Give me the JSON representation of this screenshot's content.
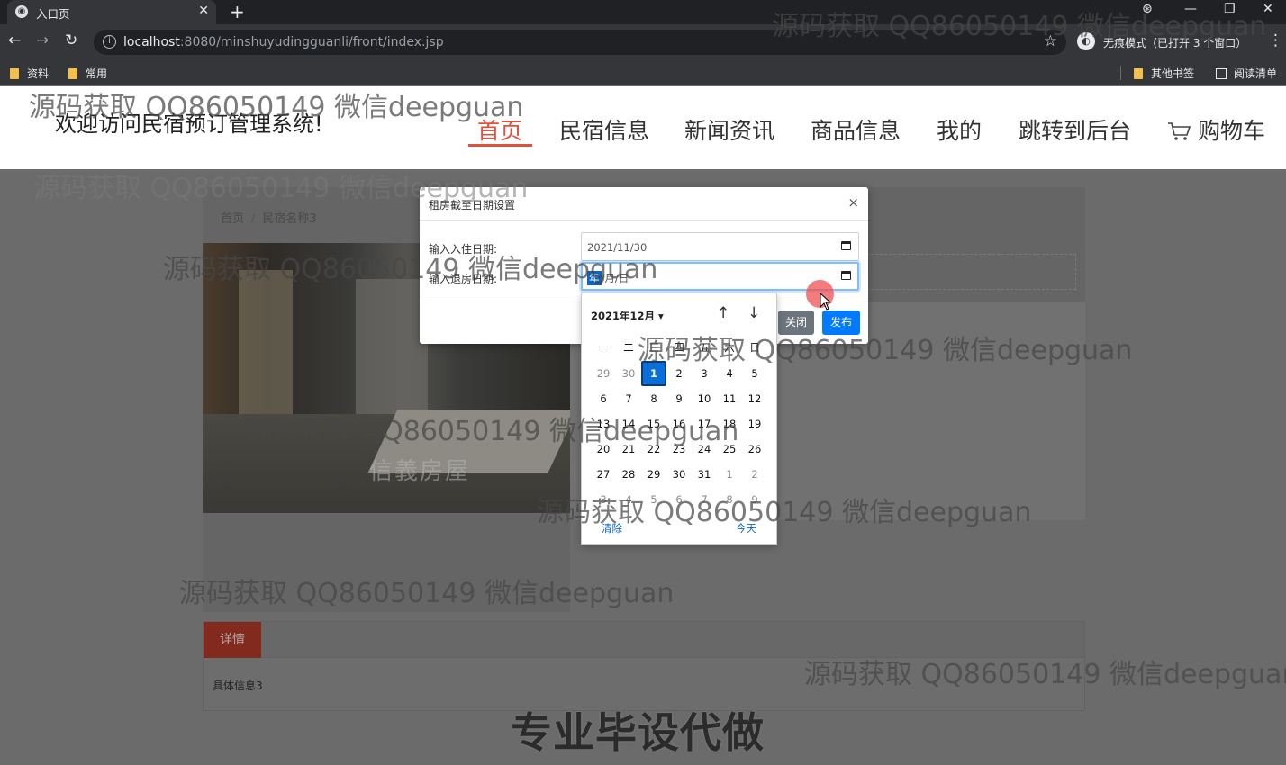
{
  "browser": {
    "tab_title": "入口页",
    "tab_close": "✕",
    "new_tab": "+",
    "url_host": "localhost",
    "url_path": ":8080/minshuyudingguanli/front/index.jsp",
    "incognito_label": "无痕模式（已打开 3 个窗口）",
    "bookmarks": [
      "资料",
      "常用"
    ],
    "bookmarks_right": [
      "其他书签",
      "阅读清单"
    ]
  },
  "site": {
    "title": "欢迎访问民宿预订管理系统!",
    "nav": [
      "首页",
      "民宿信息",
      "新闻资讯",
      "商品信息",
      "我的",
      "跳转到后台",
      "购物车"
    ],
    "active_nav": "首页",
    "accent_color": "#e0503a"
  },
  "breadcrumb": {
    "home": "首页",
    "separator": "/",
    "current": "民宿名称3"
  },
  "photo_watermark": "信義房屋",
  "detail": {
    "tab_label": "详情",
    "text": "具体信息3"
  },
  "banner": "专业毕设代做",
  "modal": {
    "title": "租房截至日期设置",
    "close_icon": "×",
    "checkin_label": "输入入住日期:",
    "checkin_value": "2021/11/30",
    "checkout_label": "输入退房日期:",
    "checkout_year_seg": "年",
    "checkout_rest": "/月/日",
    "btn_close": "关闭",
    "btn_publish": "发布"
  },
  "calendar": {
    "month_label": "2021年12月 ▾",
    "weekdays": [
      "一",
      "二",
      "三",
      "四",
      "五",
      "六",
      "日"
    ],
    "weeks": [
      [
        "29",
        "30",
        "1",
        "2",
        "3",
        "4",
        "5"
      ],
      [
        "6",
        "7",
        "8",
        "9",
        "10",
        "11",
        "12"
      ],
      [
        "13",
        "14",
        "15",
        "16",
        "17",
        "18",
        "19"
      ],
      [
        "20",
        "21",
        "22",
        "23",
        "24",
        "25",
        "26"
      ],
      [
        "27",
        "28",
        "29",
        "30",
        "31",
        "1",
        "2"
      ],
      [
        "3",
        "4",
        "5",
        "6",
        "7",
        "8",
        "9"
      ]
    ],
    "selected_day": "1",
    "clear_label": "清除",
    "today_label": "今天"
  },
  "watermark_text": "源码获取 QQ86050149 微信deepguan"
}
